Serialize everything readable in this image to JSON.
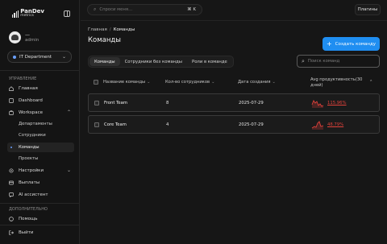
{
  "brand": {
    "line1": "PanDev",
    "line2": "metrics"
  },
  "user": {
    "name": "—",
    "role": "admin"
  },
  "org": {
    "label": "IT Department"
  },
  "sections": {
    "management": "УПРАВЛЕНИЕ",
    "additional": "ДОПОЛНИТЕЛЬНО"
  },
  "nav": {
    "home": "Главная",
    "dashboard": "Dashboard",
    "workspace": "Workspace",
    "departments": "Департаменты",
    "employees": "Сотрудники",
    "teams": "Команды",
    "projects": "Проекты",
    "settings": "Настройки",
    "payouts": "Выплаты",
    "ai": "AI ассистент",
    "help": "Помощь",
    "logout": "Выйти"
  },
  "search": {
    "placeholder": "Спроси меня...",
    "shortcut": "⌘ K"
  },
  "plugins_label": "Плагины",
  "breadcrumb": {
    "home": "Главная",
    "current": "Команды"
  },
  "page_title": "Команды",
  "create_button": "Создать команду",
  "tabs": [
    "Команды",
    "Сотрудники без команды",
    "Роли в команде"
  ],
  "table_search_placeholder": "Поиск команд",
  "columns": {
    "name": "Название команды",
    "count": "Кол-во сотрудников",
    "created": "Дата создания",
    "productivity": "Avg продуктивность(30 дней)"
  },
  "rows": [
    {
      "name": "Front Team",
      "count": "8",
      "created": "2025-07-29",
      "productivity": "115.96%"
    },
    {
      "name": "Core Team",
      "count": "4",
      "created": "2025-07-29",
      "productivity": "48.79%"
    }
  ],
  "colors": {
    "accent": "#1f8ef1",
    "danger": "#e0413a"
  },
  "icons": [
    "search-icon",
    "home-icon",
    "dashboard-icon",
    "workspace-icon",
    "settings-icon",
    "payouts-icon",
    "ai-icon",
    "help-icon",
    "logout-icon",
    "plus-icon",
    "sort-arrow-icon",
    "sparkline-icon"
  ]
}
